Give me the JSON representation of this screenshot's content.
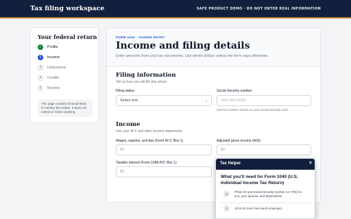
{
  "topbar": {
    "brand": "Tax filing workspace",
    "notice": "SAFE PRODUCT DEMO · DO NOT ENTER REAL INFORMATION"
  },
  "sidebar": {
    "title": "Your federal return",
    "steps": [
      {
        "marker": "✓",
        "label": "Profile",
        "state": "done"
      },
      {
        "marker": "2",
        "label": "Income",
        "state": "active"
      },
      {
        "marker": "3",
        "label": "Deductions",
        "state": "pending"
      },
      {
        "marker": "4",
        "label": "Credits",
        "state": "pending"
      },
      {
        "marker": "5",
        "label": "Review",
        "state": "pending"
      }
    ],
    "note": "This page contains fictional fields for testing Tax Helper. It does not submit or retain anything."
  },
  "main": {
    "kicker": "FORM 1040 · GUIDED ENTRY",
    "title": "Income and filing details",
    "subtitle": "Enter amounts from your tax documents. Use whole dollars unless the form says otherwise.",
    "filing": {
      "heading": "Filing information",
      "sub": "Tell us how you will file this return.",
      "status_label": "Filing status",
      "status_value": "Select one",
      "ssn_label": "Social Security number",
      "ssn_placeholder": "XXX-XX-XXXX",
      "ssn_help": "Use the number shown on your Social Security card."
    },
    "income": {
      "heading": "Income",
      "sub": "Use your W-2 and other income statements.",
      "wages_label": "Wages, salaries, and tips (Form W-2, Box 1)",
      "wages_placeholder": "$0",
      "agi_label": "Adjusted gross income (AGI)",
      "agi_placeholder": "$0",
      "interest_label": "Taxable interest (Form 1099-INT, Box 1)",
      "interest_placeholder": "$0"
    }
  },
  "helper": {
    "title": "Tax Helper",
    "close": "×",
    "question": "What you'll need for Form 1040 (U.S. Individual Income Tax Return)",
    "items": [
      {
        "num": "1",
        "text": "Photo ID and Social Security number (or ITIN) for you, your spouse, and dependents"
      },
      {
        "num": "1",
        "text": "All W-2s (one from each employer)"
      }
    ]
  },
  "colors": {
    "navy": "#13203d",
    "gold": "#b8873a",
    "accent": "#1d4ed8",
    "done": "#15803d"
  }
}
